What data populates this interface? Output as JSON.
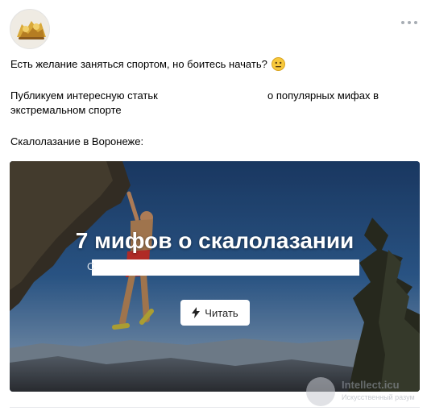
{
  "post": {
    "author_avatar_icon": "group-logo-icon",
    "more_icon": "more-dots-icon",
    "line1": "Есть желание заняться спортом, но боитесь начать?",
    "emoji_icon": "neutral-face-emoji-icon",
    "line2_a": "Публикуем интересную статьк",
    "line2_b": "о популярных мифах в",
    "line3": "экстремальном спорте",
    "line4": "Скалолазание в Воронеже:"
  },
  "card": {
    "title": "7 мифов о скалолазании",
    "subtitle_prefix": "С",
    "button_label": "Читать",
    "button_icon": "lightning-icon",
    "image_icon": "rock-climber-photo"
  },
  "watermark": {
    "name": "Intellect.icu",
    "tagline": "Искусственный разум"
  },
  "colors": {
    "text": "#000000",
    "button_bg": "#ffffff",
    "card_sky": "#2a4f80",
    "dots": "#a7adb4"
  }
}
